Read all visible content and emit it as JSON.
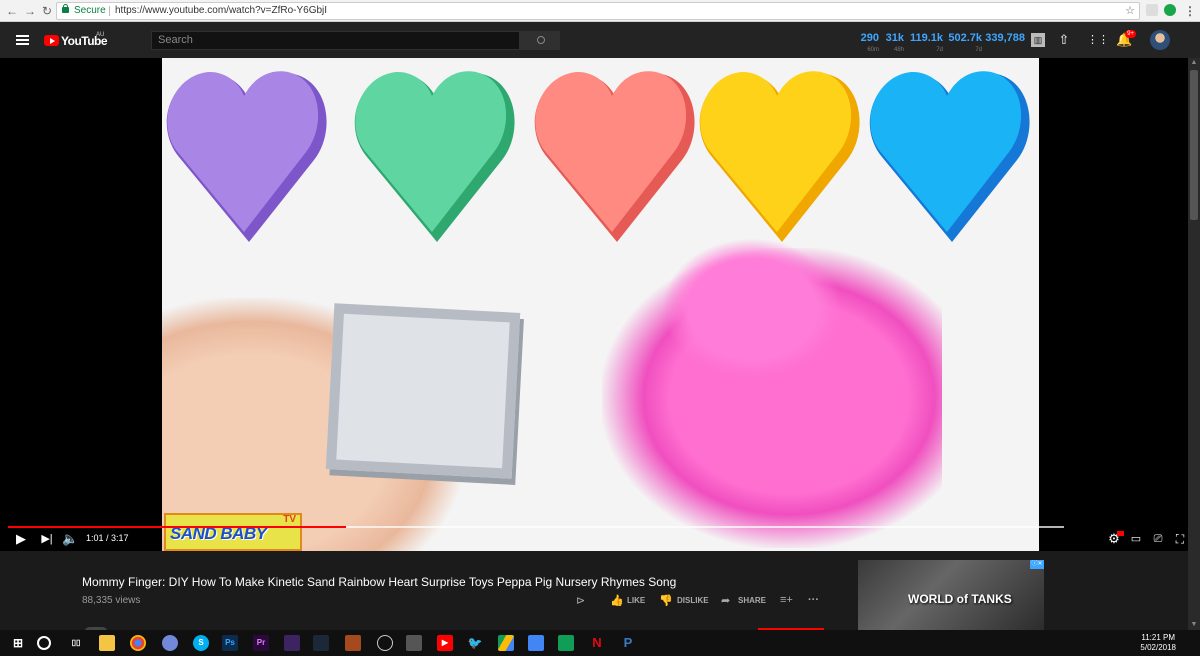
{
  "browser": {
    "secure_label": "Secure",
    "url": "https://www.youtube.com/watch?v=ZfRo-Y6GbjI",
    "star": "☆"
  },
  "header": {
    "logo_text": "YouTube",
    "logo_region": "AU",
    "search_placeholder": "Search",
    "stats": [
      {
        "value": "290",
        "sub": "60m"
      },
      {
        "value": "31k",
        "sub": "48h"
      },
      {
        "value": "119.1k",
        "sub": "7d"
      },
      {
        "value": "502.7k",
        "sub": "7d"
      },
      {
        "value": "339,788",
        "sub": ""
      }
    ],
    "notification_badge": "9+"
  },
  "player": {
    "watermark_text": "SAND BABY",
    "watermark_tv": "TV",
    "time": "1:01 / 3:17",
    "progress_fraction": 0.32,
    "loaded_fraction": 1.0
  },
  "video": {
    "title": "Mommy Finger: DIY How To Make Kinetic Sand Rainbow Heart Surprise Toys Peppa Pig Nursery Rhymes Song",
    "views": "88,335 views",
    "actions": {
      "like": "LIKE",
      "dislike": "DISLIKE",
      "share": "SHARE"
    }
  },
  "ad": {
    "text": "WORLD of TANKS",
    "badge": "ⓘ✕"
  },
  "taskbar": {
    "time": "11:21 PM",
    "date": "5/02/2018"
  },
  "colors": {
    "accent_red": "#ff0000",
    "stat_blue": "#3ea6ff"
  }
}
